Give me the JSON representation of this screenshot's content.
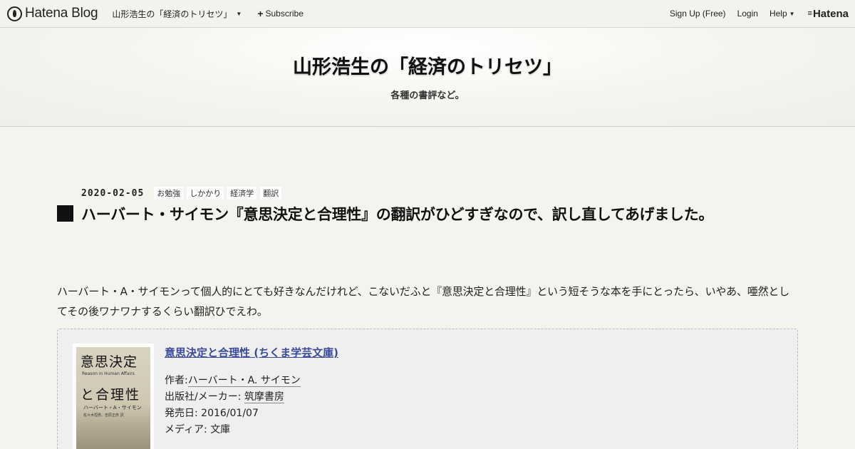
{
  "topbar": {
    "logo_text": "Hatena Blog",
    "blog_name": "山形浩生の「経済のトリセツ」",
    "subscribe_label": "Subscribe",
    "signup_label": "Sign Up (Free)",
    "login_label": "Login",
    "help_label": "Help",
    "brand_label": "Hatena"
  },
  "header": {
    "title": "山形浩生の「経済のトリセツ」",
    "description": "各種の書評など。"
  },
  "entry": {
    "date": "2020-02-05",
    "categories": [
      "お勉強",
      "しかかり",
      "経済学",
      "翻訳"
    ],
    "title": "ハーバート・サイモン『意思決定と合理性』の翻訳がひどすぎなので、訳し直してあげました。",
    "body": "ハーバート・A・サイモンって個人的にとても好きなんだけれど、こないだふと『意思決定と合理性』という短そうな本を手にとったら、いやあ、唖然としてその後ワナワナするくらい翻訳ひでえわ。"
  },
  "book": {
    "title": "意思決定と合理性 (ちくま学芸文庫)",
    "author_label": "作者:",
    "author": "ハーバート・A. サイモン",
    "publisher_label": "出版社/メーカー: ",
    "publisher": "筑摩書房",
    "release_label": "発売日: ",
    "release": "2016/01/07",
    "media_label": "メディア: ",
    "media": "文庫",
    "cover": {
      "title_line1": "意思決定",
      "title_line2": "と合理性",
      "subtitle": "Reason in Human Affairs",
      "author": "ハーバート・A・サイモン",
      "translators": "佐々木恒男、吉原正彦 訳"
    }
  },
  "colors": {
    "background": "#f4f4ef",
    "book_link": "#3a4a9a",
    "title_square": "#111111"
  }
}
